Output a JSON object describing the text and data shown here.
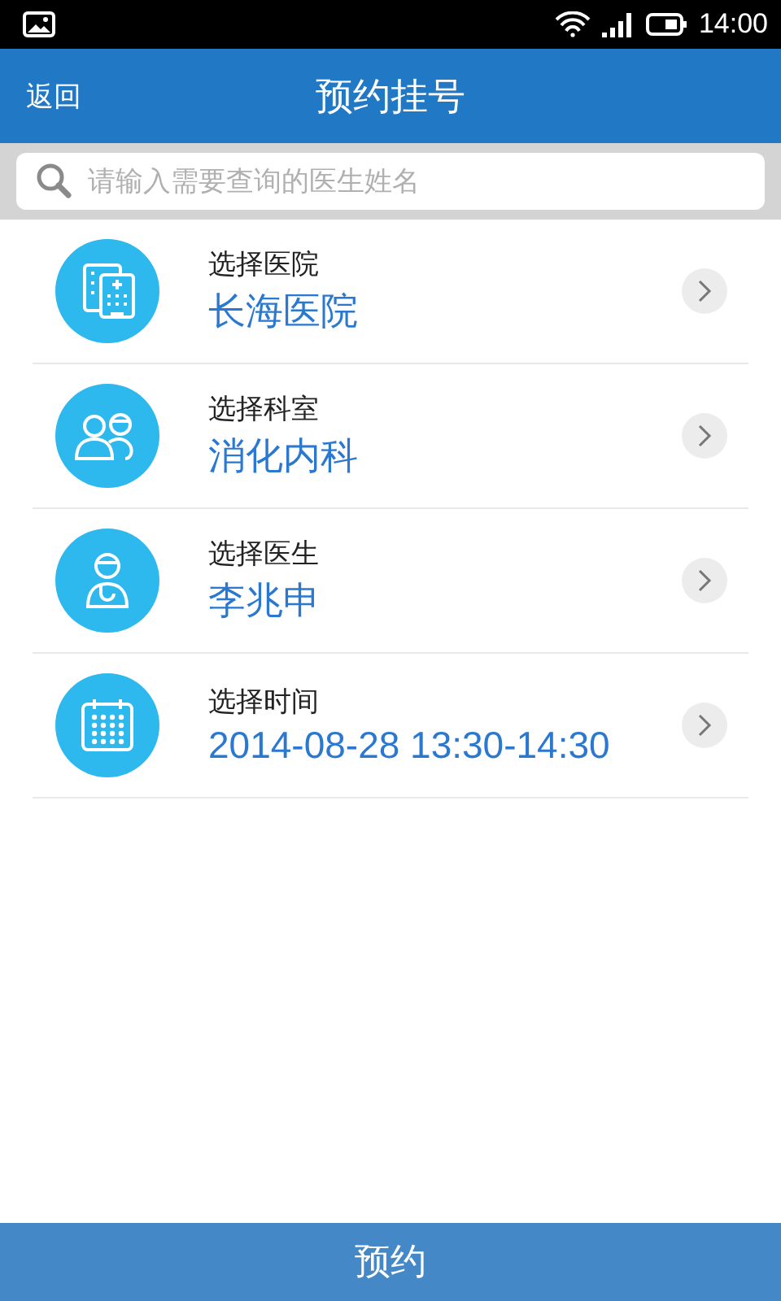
{
  "status_bar": {
    "time": "14:00"
  },
  "header": {
    "back": "返回",
    "title": "预约挂号"
  },
  "search": {
    "placeholder": "请输入需要查询的医生姓名"
  },
  "items": [
    {
      "kind": "hospital",
      "label": "选择医院",
      "value": "长海医院"
    },
    {
      "kind": "department",
      "label": "选择科室",
      "value": "消化内科"
    },
    {
      "kind": "doctor",
      "label": "选择医生",
      "value": "李兆申"
    },
    {
      "kind": "time",
      "label": "选择时间",
      "value": "2014-08-28 13:30-14:30"
    }
  ],
  "submit": "预约"
}
